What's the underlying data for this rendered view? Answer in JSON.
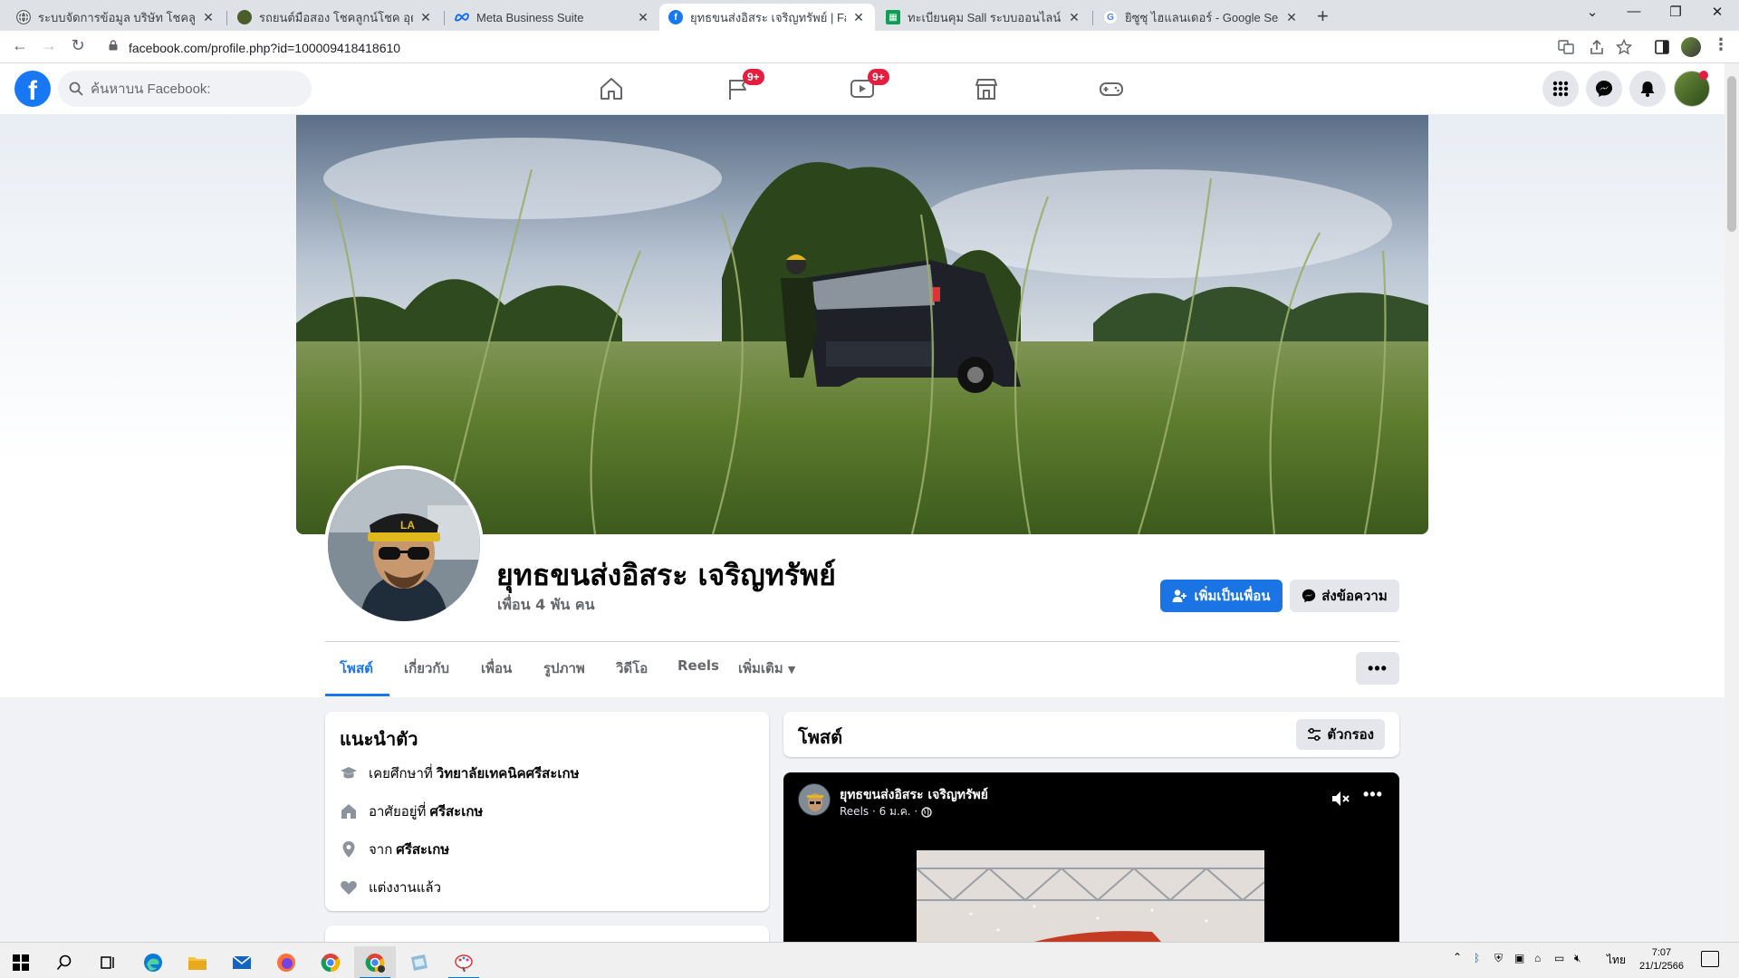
{
  "browser": {
    "tabs": [
      {
        "title": "ระบบจัดการข้อมูล บริษัท โชคลูกน์โชค อ"
      },
      {
        "title": "รถยนต์มือสอง โชคลูกน์โชค อุดรธานี"
      },
      {
        "title": "Meta Business Suite"
      },
      {
        "title": "ยุทธขนส่งอิสระ เจริญทรัพย์ | Faceboo"
      },
      {
        "title": "ทะเบียนคุม Sall ระบบออนไลน์.xlsx - G"
      },
      {
        "title": "ยิซูซุ ไฮแลนเดอร์ - Google Search"
      }
    ],
    "url": "facebook.com/profile.php?id=100009418418610"
  },
  "fb_nav": {
    "search_placeholder": "ค้นหาบน Facebook:",
    "badges": {
      "groups": "9+",
      "watch": "9+"
    }
  },
  "profile": {
    "name": "ยุทธขนส่งอิสระ เจริญทรัพย์",
    "friends": "เพื่อน 4 พัน คน",
    "add_friend_label": "เพิ่มเป็นเพื่อน",
    "message_label": "ส่งข้อความ",
    "tabs": [
      "โพสต์",
      "เกี่ยวกับ",
      "เพื่อน",
      "รูปภาพ",
      "วิดีโอ",
      "Reels",
      "เพิ่มเติม"
    ],
    "more_label": "•••"
  },
  "intro": {
    "title": "แนะนำตัว",
    "items": [
      {
        "prefix": "เคยศึกษาที่",
        "value": "วิทยาลัยเทคนิคศรีสะเกษ"
      },
      {
        "prefix": "อาศัยอยู่ที่",
        "value": "ศรีสะเกษ"
      },
      {
        "prefix": "จาก",
        "value": "ศรีสะเกษ"
      },
      {
        "prefix": "แต่งงานแล้ว",
        "value": ""
      }
    ]
  },
  "posts": {
    "title": "โพสต์",
    "filter_label": "ตัวกรอง"
  },
  "reel_post": {
    "author": "ยุทธขนส่งอิสระ เจริญทรัพย์",
    "meta": "Reels · 6 ม.ค. ·",
    "more_label": "•••"
  },
  "taskbar": {
    "lang": "ไทย",
    "time": "7:07",
    "date": "21/1/2566"
  },
  "colors": {
    "fb_blue": "#1877f2",
    "badge_red": "#e41e3f",
    "button_grey": "#e4e6eb"
  }
}
